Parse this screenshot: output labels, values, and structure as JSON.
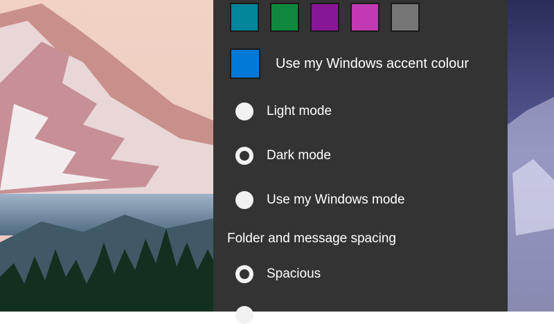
{
  "theme": {
    "swatches": [
      {
        "name": "teal",
        "color": "#03859a"
      },
      {
        "name": "green",
        "color": "#10893e"
      },
      {
        "name": "purple",
        "color": "#881798"
      },
      {
        "name": "magenta",
        "color": "#c239b3"
      },
      {
        "name": "gray",
        "color": "#767676"
      }
    ],
    "accent": {
      "label": "Use my Windows accent colour",
      "color": "#0078d7"
    }
  },
  "mode": {
    "options": [
      {
        "label": "Light mode",
        "selected": false
      },
      {
        "label": "Dark mode",
        "selected": true
      },
      {
        "label": "Use my Windows mode",
        "selected": false
      }
    ]
  },
  "spacing": {
    "title": "Folder and message spacing",
    "options": [
      {
        "label": "Spacious",
        "selected": true
      }
    ]
  },
  "colors": {
    "panel_bg": "#333333",
    "text": "#ffffff",
    "radio": "#f2f2f2"
  }
}
